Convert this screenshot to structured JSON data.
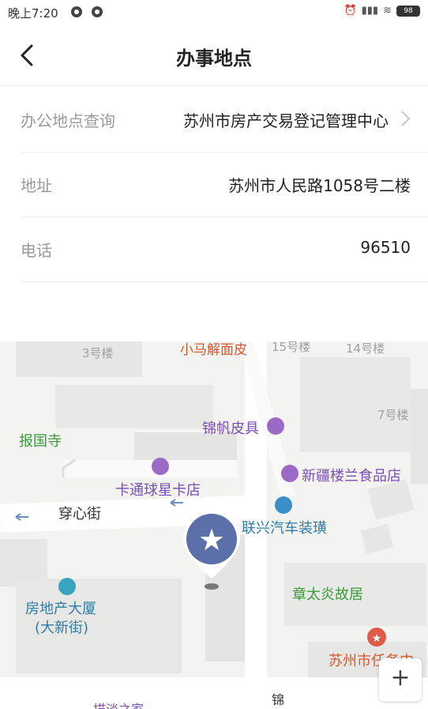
{
  "status": {
    "time": "晚上7:20",
    "battery": "98"
  },
  "header": {
    "title": "办事地点"
  },
  "rows": [
    {
      "label": "办公地点查询",
      "value": "苏州市房产交易登记管理中心"
    },
    {
      "label": "地址",
      "value": "苏州市人民路1058号二楼"
    },
    {
      "label": "电话",
      "value": "96510"
    }
  ],
  "map": {
    "labels": {
      "building3": "3号楼",
      "xiaoma": "小马解面皮",
      "building15": "15号楼",
      "building14": "14号楼",
      "building7": "7号楼",
      "baoguosi": "报国寺",
      "jinfan": "锦帆皮具",
      "xinjiang": "新疆楼兰食品店",
      "katong": "卡通球星卡店",
      "chuanxinjie": "穿心街",
      "lianxing": "联兴汽车装璜",
      "fangdichan_line1": "房地产大厦",
      "fangdichan_line2": "(大新街)",
      "zhangtaiyan": "章太炎故居",
      "suzhou_red": "苏州市任务中",
      "bottom_left": "描淡之家",
      "bottom_mid": "锦"
    },
    "zoom_in": "+"
  }
}
